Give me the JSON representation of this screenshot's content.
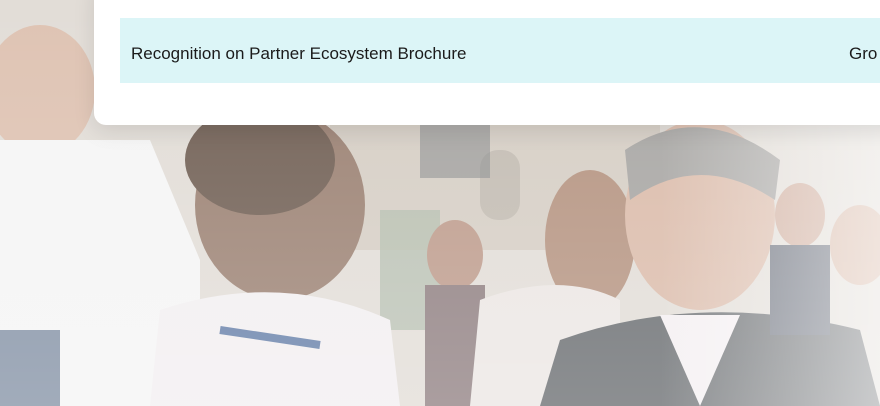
{
  "benefits_table": {
    "rows": [
      {
        "benefit": "Recognition on Partner Ecosystem Brochure",
        "tier": "Gro"
      }
    ]
  },
  "background": {
    "type": "faded-event-photo",
    "colors": {
      "row_highlight": "#dcf5f7",
      "card": "#ffffff"
    }
  }
}
